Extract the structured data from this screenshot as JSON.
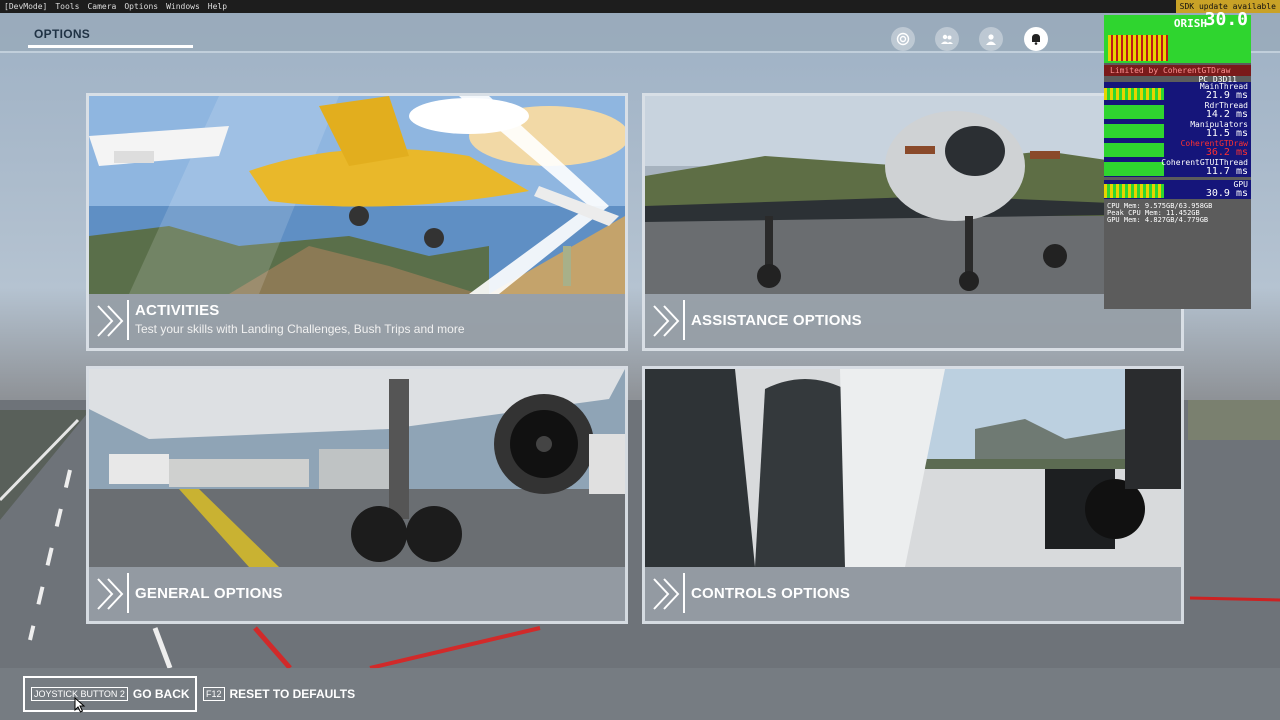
{
  "devbar": {
    "items": [
      "[DevMode]",
      "Tools",
      "Camera",
      "Options",
      "Windows",
      "Help"
    ],
    "sdk_notice": "SDK update available"
  },
  "header": {
    "tab_label": "OPTIONS",
    "icons": [
      "target-icon",
      "community-icon",
      "profile-icon",
      "notification-bell-icon"
    ]
  },
  "cards": {
    "activities": {
      "title": "ACTIVITIES",
      "subtitle": "Test your skills with Landing Challenges, Bush Trips and more"
    },
    "assistance": {
      "title": "ASSISTANCE OPTIONS"
    },
    "general": {
      "title": "GENERAL OPTIONS"
    },
    "controls": {
      "title": "CONTROLS OPTIONS"
    }
  },
  "perf": {
    "fps": "30.0",
    "name": "ORISH",
    "limited": "Limited by CoherentGTDraw",
    "pc": "PC D3D11",
    "main_thread": {
      "label": "MainThread",
      "value": "21.9 ms"
    },
    "rdr_thread": {
      "label": "RdrThread",
      "value": "14.2 ms"
    },
    "manipulators": {
      "label": "Manipulators",
      "value": "11.5 ms"
    },
    "coherent_draw": {
      "label": "CoherentGTDraw",
      "value": "36.2 ms"
    },
    "coherent_ui": {
      "label": "CoherentGTUIThread",
      "value": "11.7 ms"
    },
    "gpu": {
      "label": "GPU",
      "value": "30.9 ms"
    },
    "cpu_mem": "CPU Mem: 9.575GB/63.958GB",
    "peak_mem": "Peak CPU Mem: 11.452GB",
    "gpu_mem": "GPU Mem: 4.827GB/4.779GB",
    "colors": {
      "bar": "#2fd52f",
      "row": "#15157a",
      "warn": "#ff3030"
    }
  },
  "footer": {
    "back_key": "JOYSTICK BUTTON 2",
    "back_label": "GO BACK",
    "reset_key": "F12",
    "reset_label": "RESET TO DEFAULTS"
  }
}
